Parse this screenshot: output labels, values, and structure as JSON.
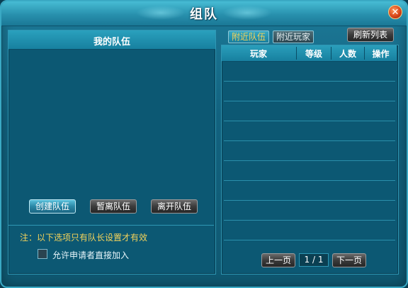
{
  "window": {
    "title": "组队",
    "close_label": "✕"
  },
  "my_team": {
    "header": "我的队伍",
    "buttons": {
      "create": "创建队伍",
      "pause": "暂离队伍",
      "leave": "离开队伍"
    },
    "note": "注：以下选项只有队长设置才有效",
    "option_auto_join": {
      "label": "允许申请者直接加入",
      "checked": false
    }
  },
  "nearby": {
    "tabs": [
      {
        "label": "附近队伍",
        "active": true
      },
      {
        "label": "附近玩家",
        "active": false
      }
    ],
    "refresh_label": "刷新列表",
    "columns": [
      "玩家",
      "等级",
      "人数",
      "操作"
    ],
    "rows": [],
    "pager": {
      "prev_label": "上一页",
      "next_label": "下一页",
      "page_text": "1 / 1"
    }
  },
  "colors": {
    "accent": "#2a9ebb",
    "note_text": "#f3d25a",
    "panel_bg": "#0c5873"
  }
}
